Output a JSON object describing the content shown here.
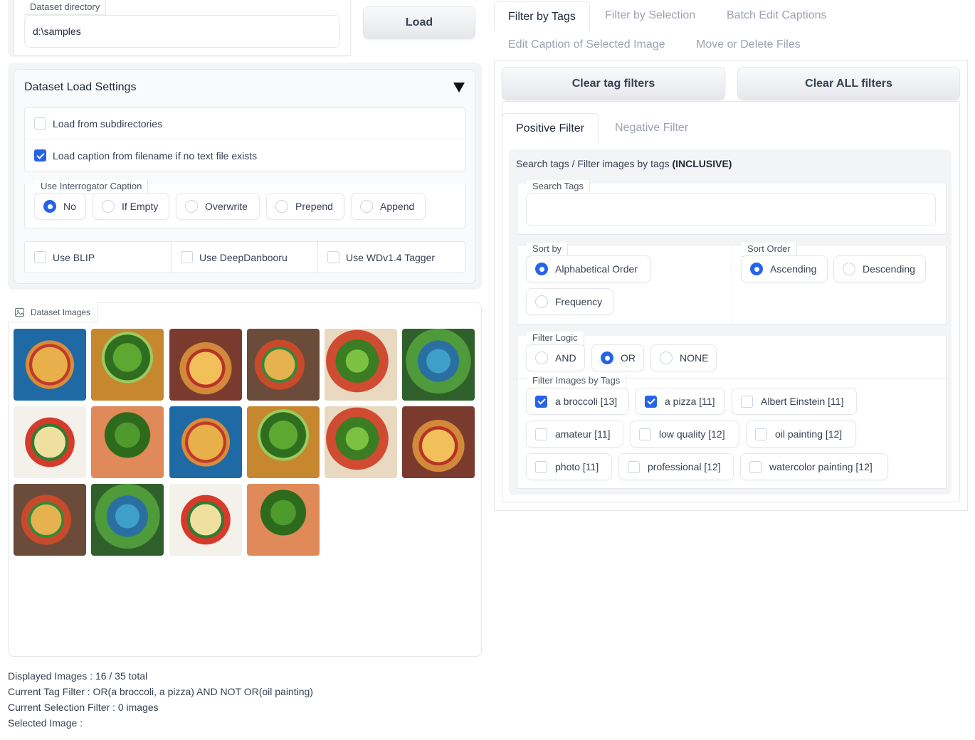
{
  "dataset_dir": {
    "label": "Dataset directory",
    "value": "d:\\samples"
  },
  "load_button": "Load",
  "load_settings": {
    "title": "Dataset Load Settings",
    "toggle_icon": "triangle-down",
    "load_subdirs": {
      "label": "Load from subdirectories",
      "checked": false
    },
    "caption_from_filename": {
      "label": "Load caption from filename if no text file exists",
      "checked": true
    },
    "interrogator": {
      "label": "Use Interrogator Caption",
      "options": [
        "No",
        "If Empty",
        "Overwrite",
        "Prepend",
        "Append"
      ],
      "selected": "No"
    },
    "use_blip": {
      "label": "Use BLIP",
      "checked": false
    },
    "use_deepdanbooru": {
      "label": "Use DeepDanbooru",
      "checked": false
    },
    "use_wd": {
      "label": "Use WDv1.4 Tagger",
      "checked": false
    }
  },
  "gallery": {
    "label": "Dataset Images",
    "icon": "image-icon",
    "images": [
      {
        "subject": "pizza"
      },
      {
        "subject": "broccoli"
      },
      {
        "subject": "pizza"
      },
      {
        "subject": "pizza"
      },
      {
        "subject": "broccoli"
      },
      {
        "subject": "broccoli"
      },
      {
        "subject": "pizza"
      },
      {
        "subject": "broccoli"
      },
      {
        "subject": "pizza"
      },
      {
        "subject": "broccoli"
      },
      {
        "subject": "broccoli"
      },
      {
        "subject": "pizza"
      },
      {
        "subject": "pizza"
      },
      {
        "subject": "broccoli"
      },
      {
        "subject": "pizza"
      },
      {
        "subject": "broccoli"
      }
    ]
  },
  "status": {
    "displayed": "Displayed Images : 16 / 35 total",
    "tag_filter": "Current Tag Filter : OR(a broccoli, a pizza) AND NOT OR(oil painting)",
    "selection_filter": "Current Selection Filter : 0 images",
    "selected_image": "Selected Image :"
  },
  "tabs": {
    "items": [
      "Filter by Tags",
      "Filter by Selection",
      "Batch Edit Captions",
      "Edit Caption of Selected Image",
      "Move or Delete Files"
    ],
    "active": "Filter by Tags"
  },
  "filter": {
    "clear_tag_filters": "Clear tag filters",
    "clear_all_filters": "Clear ALL filters",
    "subtabs": [
      "Positive Filter",
      "Negative Filter"
    ],
    "active_subtab": "Positive Filter",
    "search_heading_prefix": "Search tags / Filter images by tags",
    "search_heading_bold": "(INCLUSIVE)",
    "search_tags": {
      "label": "Search Tags",
      "value": ""
    },
    "sort_by": {
      "label": "Sort by",
      "options": [
        "Alphabetical Order",
        "Frequency"
      ],
      "selected": "Alphabetical Order"
    },
    "sort_order": {
      "label": "Sort Order",
      "options": [
        "Ascending",
        "Descending"
      ],
      "selected": "Ascending"
    },
    "filter_logic": {
      "label": "Filter Logic",
      "options": [
        "AND",
        "OR",
        "NONE"
      ],
      "selected": "OR"
    },
    "filter_tags": {
      "label": "Filter Images by Tags",
      "tags": [
        {
          "label": "a broccoli [13]",
          "checked": true
        },
        {
          "label": "a pizza [11]",
          "checked": true
        },
        {
          "label": "Albert Einstein [11]",
          "checked": false
        },
        {
          "label": "amateur [11]",
          "checked": false
        },
        {
          "label": "low quality [12]",
          "checked": false
        },
        {
          "label": "oil painting [12]",
          "checked": false
        },
        {
          "label": "photo [11]",
          "checked": false
        },
        {
          "label": "professional [12]",
          "checked": false
        },
        {
          "label": "watercolor painting [12]",
          "checked": false
        }
      ]
    }
  },
  "colors": {
    "accent": "#2563eb",
    "border": "#e5e7eb",
    "panel_bg": "#f3f4f6"
  }
}
